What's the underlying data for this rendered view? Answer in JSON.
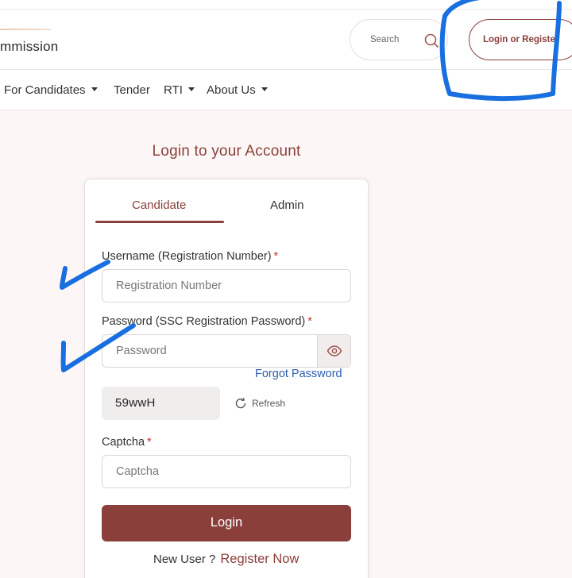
{
  "header": {
    "brand_partial": "mmission",
    "search_placeholder": "Search",
    "login_button": "Login or Registe"
  },
  "nav": {
    "items": [
      {
        "label": "For Candidates",
        "dropdown": true
      },
      {
        "label": "Tender",
        "dropdown": false
      },
      {
        "label": "RTI",
        "dropdown": true
      },
      {
        "label": "About Us",
        "dropdown": true
      }
    ]
  },
  "main": {
    "title": "Login to your Account"
  },
  "form": {
    "tabs": [
      {
        "label": "Candidate",
        "active": true
      },
      {
        "label": "Admin",
        "active": false
      }
    ],
    "username_label": "Username (Registration Number)",
    "username_placeholder": "Registration Number",
    "password_label": "Password (SSC Registration Password)",
    "password_placeholder": "Password",
    "required_mark": "*",
    "forgot_password": "Forgot Password",
    "captcha_code": "59wwH",
    "refresh_label": "Refresh",
    "captcha_label": "Captcha",
    "captcha_placeholder": "Captcha",
    "submit_label": "Login",
    "new_user_text": "New User ?",
    "register_link": "Register Now"
  },
  "colors": {
    "accent": "#8b3f3a",
    "link": "#2a5db0",
    "annotation": "#1a6fe0",
    "background": "#fcf7f6"
  }
}
